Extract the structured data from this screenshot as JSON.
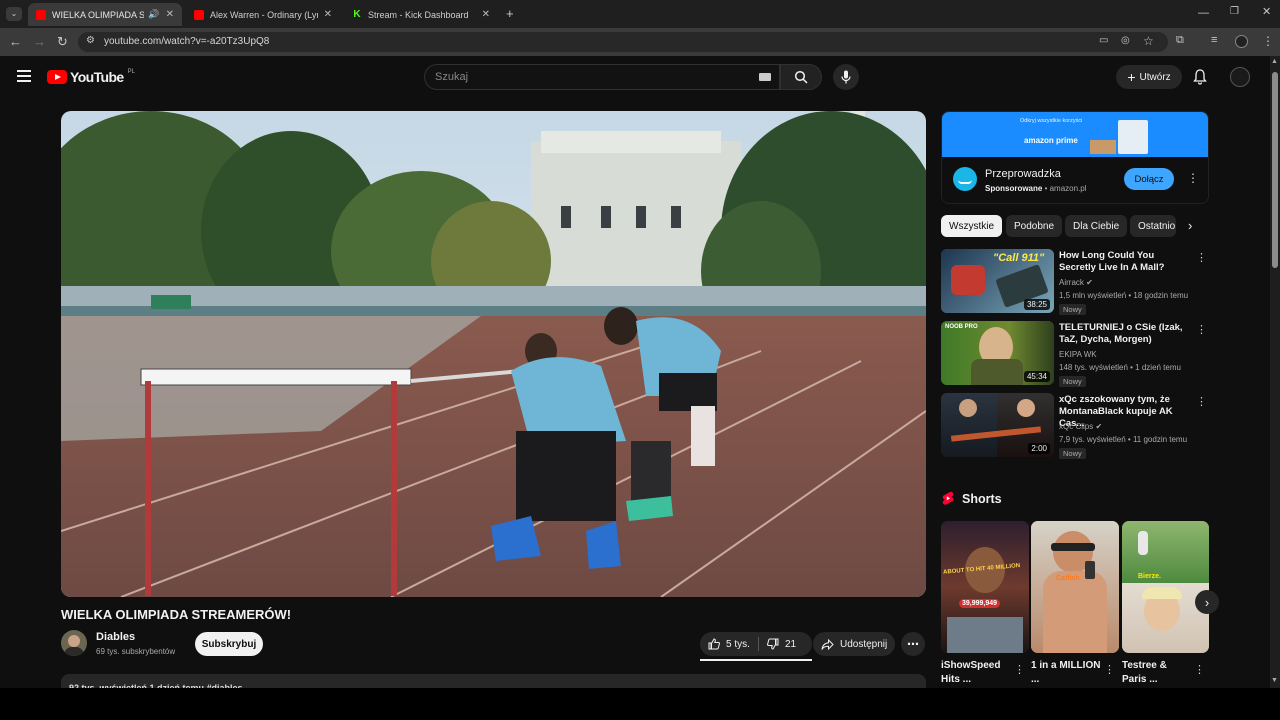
{
  "browser": {
    "tabs": [
      {
        "title": "WIELKA OLIMPIADA STREA",
        "active": true,
        "favicon_color": "#ff0000"
      },
      {
        "title": "Alex Warren - Ordinary (Lyrics)",
        "active": false,
        "favicon_color": "#ff0000"
      },
      {
        "title": "Stream - Kick Dashboard",
        "active": false,
        "favicon_color": "#53fc18"
      }
    ],
    "new_tab": "+",
    "url": "youtube.com/watch?v=-a20Tz3UpQ8"
  },
  "header": {
    "logo_text": "YouTube",
    "region": "PL",
    "search_placeholder": "Szukaj",
    "create_label": "Utwórz"
  },
  "video": {
    "title": "WIELKA OLIMPIADA STREAMERÓW!",
    "channel": "Diables",
    "subscribers": "69 tys. subskrybentów",
    "subscribe_label": "Subskrybuj",
    "likes": "5 tys.",
    "dislikes": "21",
    "share_label": "Udostępnij",
    "description_line": "92 tys. wyświetleń  1 dzień temu  #diables"
  },
  "ad": {
    "banner_text": "Odkryj wszystkie korzyści",
    "banner_brand": "amazon prime",
    "title": "Przeprowadzka",
    "sponsored": "Sponsorowane",
    "domain": "amazon.pl",
    "cta": "Dołącz"
  },
  "chips": [
    {
      "label": "Wszystkie",
      "active": true
    },
    {
      "label": "Podobne",
      "active": false
    },
    {
      "label": "Dla Ciebie",
      "active": false
    },
    {
      "label": "Ostatnio",
      "active": false
    }
  ],
  "recommendations": [
    {
      "title": "How Long Could You Secretly Live In A Mall?",
      "channel": "Airrack",
      "verified": true,
      "meta": "1,5 mln wyświetleń • 18 godzin temu",
      "badge": "Nowy",
      "duration": "38:25",
      "thumb_text": "\"Call 911\""
    },
    {
      "title": "TELETURNIEJ o CSie (Izak, TaZ, Dycha, Morgen)",
      "channel": "EKIPA WK",
      "verified": false,
      "meta": "148 tys. wyświetleń • 1 dzień temu",
      "badge": "Nowy",
      "duration": "45:34",
      "thumb_text": "NOOB  PRO"
    },
    {
      "title": "xQc zszokowany tym, że MontanaBlack kupuje AK Cas...",
      "channel": "xQc Clips",
      "verified": true,
      "meta": "7,9 tys. wyświetleń • 11 godzin temu",
      "badge": "Nowy",
      "duration": "2:00",
      "thumb_text": ""
    }
  ],
  "shorts": {
    "heading": "Shorts",
    "items": [
      {
        "title": "iShowSpeed Hits ...",
        "overlay": "ABOUT TO HIT 40 MILLION",
        "counter": "39,999,949"
      },
      {
        "title": "1 in a MILLION ...",
        "overlay": "Catfish",
        "counter": ""
      },
      {
        "title": "Testree & Paris ...",
        "overlay": "Bierze.",
        "counter": ""
      }
    ]
  }
}
